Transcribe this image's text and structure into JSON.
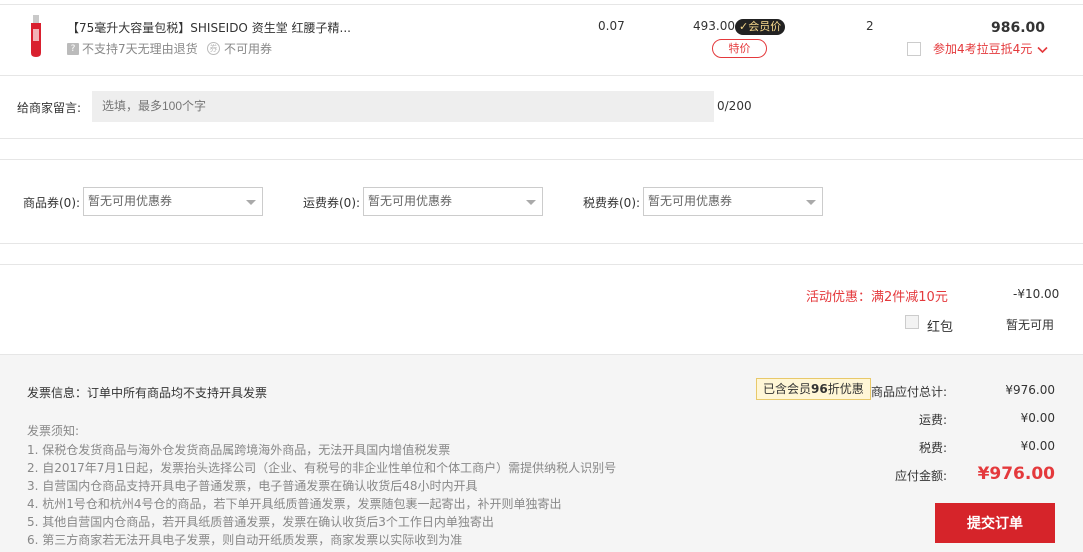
{
  "product": {
    "title": "【75毫升大容量包税】SHISEIDO 资生堂 红腰子精...",
    "no_return_text": "不支持7天无理由退货",
    "no_coupon_text": "不可用券",
    "weight": "0.07",
    "price": "493.00",
    "vip_badge": "会员价",
    "promo_tag": "特价",
    "qty": "2",
    "total": "986.00",
    "offer_text": "参加4考拉豆抵4元",
    "thumb_color": "#d9202f"
  },
  "message": {
    "label": "给商家留言:",
    "placeholder": "选填，最多100个字",
    "count": "0/200"
  },
  "coupons": [
    {
      "label": "商品券(0):",
      "value": "暂无可用优惠券"
    },
    {
      "label": "运费券(0):",
      "value": "暂无可用优惠券"
    },
    {
      "label": "税费券(0):",
      "value": "暂无可用优惠券"
    }
  ],
  "discount": {
    "activity_label": "活动优惠：满2件减10元",
    "activity_value": "-¥10.00",
    "red_packet_label": "红包",
    "red_packet_value": "暂无可用"
  },
  "invoice": {
    "title": "发票信息：订单中所有商品均不支持开具发票",
    "notice_title": "发票须知:",
    "notices": [
      "1. 保税仓发货商品与海外仓发货商品属跨境海外商品，无法开具国内增值税发票",
      "2. 自2017年7月1日起，发票抬头选择公司（企业、有税号的非企业性单位和个体工商户）需提供纳税人识别号",
      "3. 自营国内仓商品支持开具电子普通发票，电子普通发票在确认收货后48小时内开具",
      "4. 杭州1号仓和杭州4号仓的商品，若下单开具纸质普通发票，发票随包裹一起寄出，补开则单独寄出",
      "5. 其他自营国内仓商品，若开具纸质普通发票，发票在确认收货后3个工作日内单独寄出",
      "6. 第三方商家若无法开具电子发票，则自动开纸质发票，商家发票以实际收到为准"
    ]
  },
  "summary": {
    "vip_discount_prefix": "已含会员",
    "vip_discount_bold": "96",
    "vip_discount_suffix": "折优惠",
    "goods_total_label": "商品应付总计:",
    "goods_total_value": "¥976.00",
    "shipping_label": "运费:",
    "shipping_value": "¥0.00",
    "tax_label": "税费:",
    "tax_value": "¥0.00",
    "pay_label": "应付金额:",
    "pay_value": "¥976.00",
    "submit_label": "提交订单"
  },
  "colors": {
    "accent_red": "#e4393c",
    "submit_bg": "#d6242a"
  }
}
